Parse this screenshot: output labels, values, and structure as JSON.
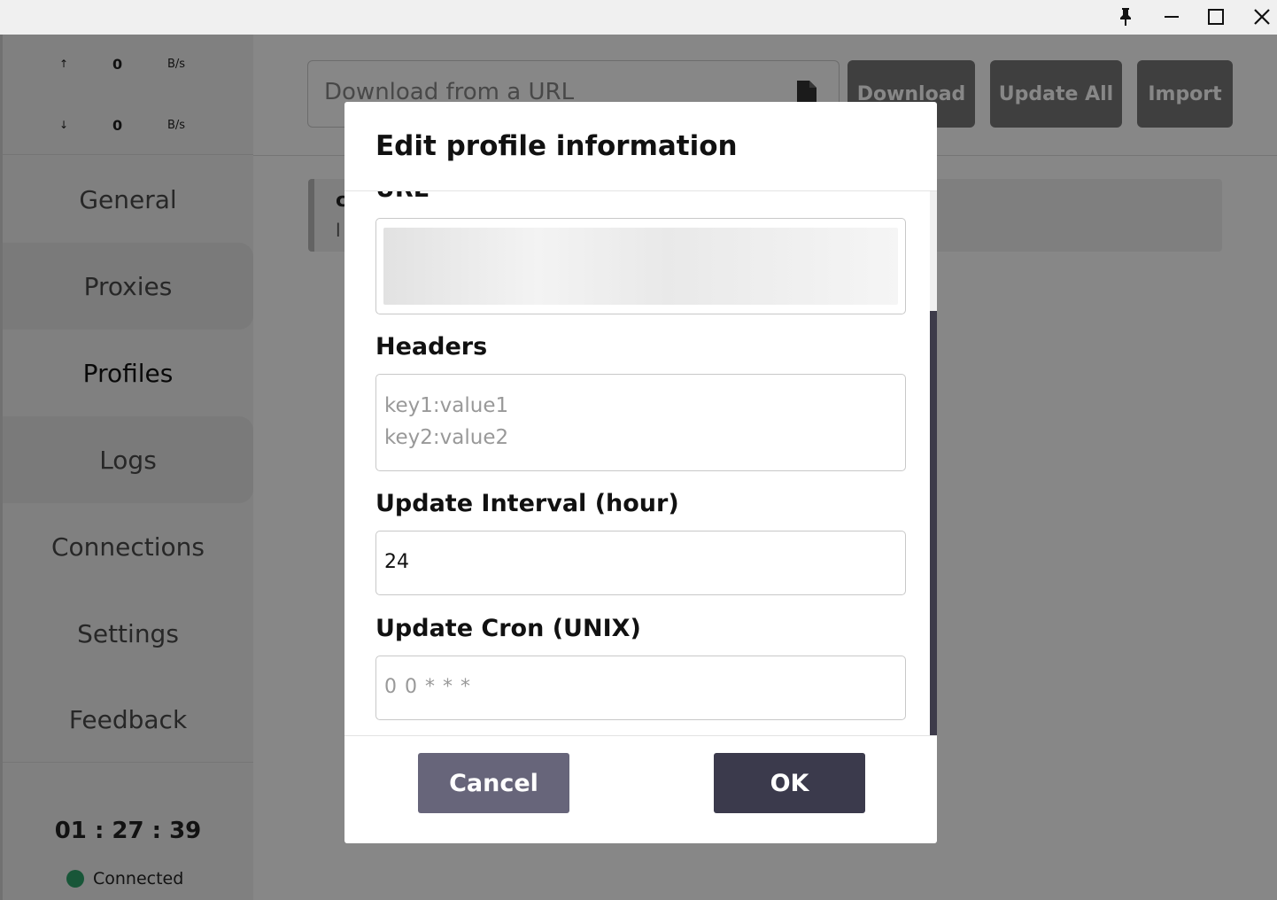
{
  "window": {
    "pin_icon": "pin-icon",
    "minimize_icon": "minimize-icon",
    "maximize_icon": "maximize-icon",
    "close_icon": "close-icon"
  },
  "traffic": {
    "up_arrow": "↑",
    "up_value": "0",
    "up_unit": "B/s",
    "down_arrow": "↓",
    "down_value": "0",
    "down_unit": "B/s"
  },
  "sidebar": {
    "items": [
      {
        "label": "General"
      },
      {
        "label": "Proxies"
      },
      {
        "label": "Profiles"
      },
      {
        "label": "Logs"
      },
      {
        "label": "Connections"
      },
      {
        "label": "Settings"
      },
      {
        "label": "Feedback"
      }
    ],
    "active": "Profiles",
    "clock": "01 : 27 : 39",
    "status": "Connected",
    "status_color": "#2fa36b"
  },
  "main": {
    "url_placeholder": "Download from a URL",
    "download_label": "Download",
    "update_all_label": "Update All",
    "import_label": "Import",
    "profile_card": {
      "title": "c",
      "subtitle": "l"
    }
  },
  "dialog": {
    "title": "Edit profile information",
    "url_label": "URL",
    "headers_label": "Headers",
    "headers_placeholder_line1": "key1:value1",
    "headers_placeholder_line2": "key2:value2",
    "interval_label": "Update Interval (hour)",
    "interval_value": "24",
    "cron_label": "Update Cron (UNIX)",
    "cron_placeholder": "0 0 * * *",
    "cancel_label": "Cancel",
    "ok_label": "OK",
    "accent_color": "#3b3a4c"
  }
}
